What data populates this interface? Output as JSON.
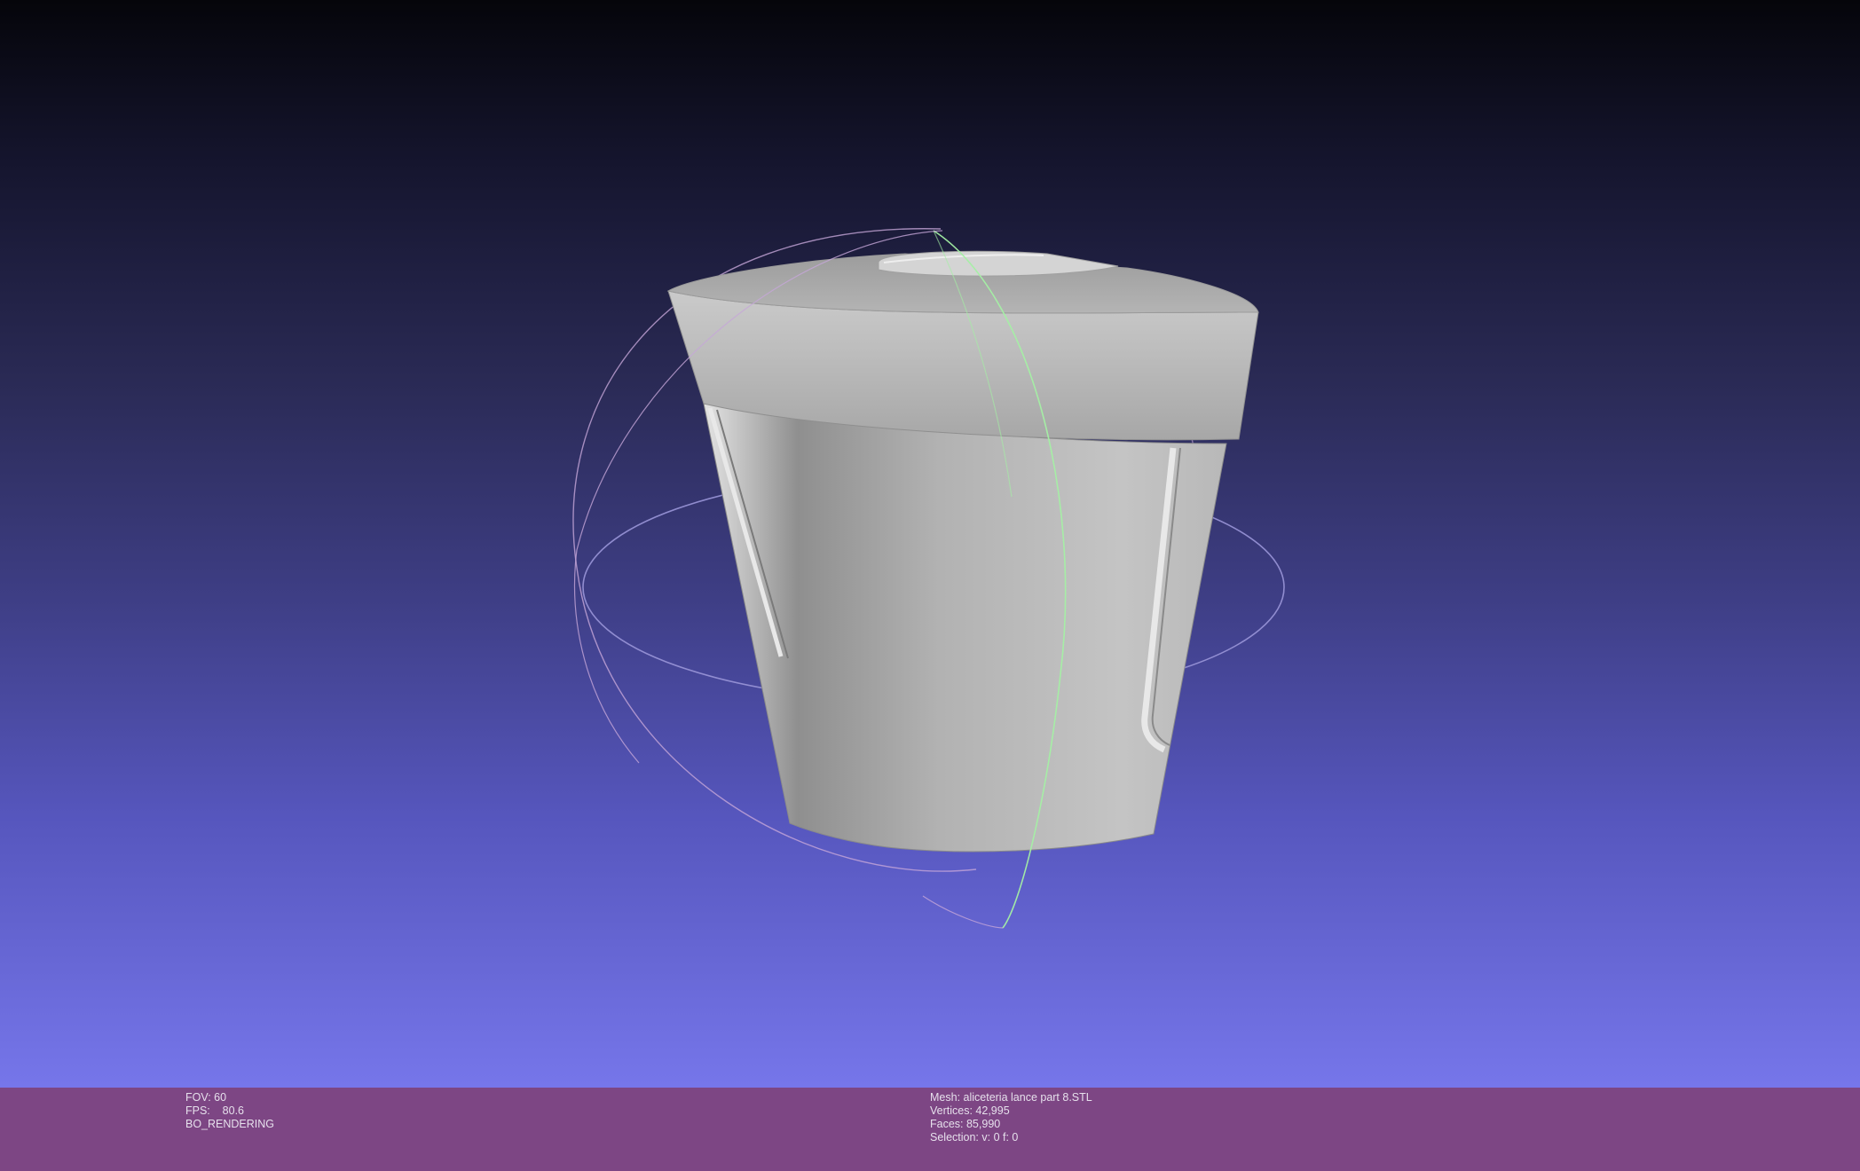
{
  "viewer": {
    "background_top": "#05050a",
    "background_bottom": "#7676ea",
    "trackball_horizontal_color": "#9a96d8",
    "trackball_vertical_color": "#a4f0a4",
    "trackball_side_color": "#c6a6d8",
    "mesh_color": "#b8b8b8"
  },
  "status_left": {
    "fov": "FOV: 60",
    "fps": "FPS:    80.6",
    "mode": "BO_RENDERING"
  },
  "status_right": {
    "mesh": "Mesh: aliceteria lance part 8.STL",
    "vertices": "Vertices: 42,995",
    "faces": "Faces: 85,990",
    "selection": "Selection: v: 0 f: 0"
  },
  "info_bar_color": "#7d4684"
}
